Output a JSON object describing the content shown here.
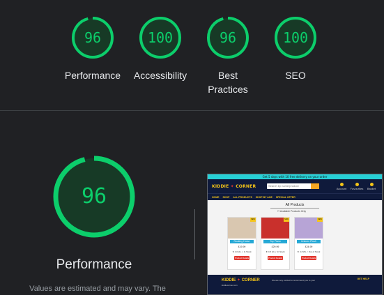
{
  "gauges": [
    {
      "score": "96",
      "label": "Performance",
      "color": "#0cce6b",
      "fraction": 0.96
    },
    {
      "score": "100",
      "label": "Accessibility",
      "color": "#0cce6b",
      "fraction": 1.0
    },
    {
      "score": "96",
      "label": "Best Practices",
      "color": "#0cce6b",
      "fraction": 0.96
    },
    {
      "score": "100",
      "label": "SEO",
      "color": "#0cce6b",
      "fraction": 1.0
    }
  ],
  "performance": {
    "score": "96",
    "fraction": 0.96,
    "title": "Performance",
    "note": "Values are estimated and may vary. The"
  },
  "thumbnail": {
    "banner": "Get 5 days with 10 free delivery on your order",
    "logo_left": "KIDDIE",
    "logo_right": "CORNER",
    "search_placeholder": "Search by name/product",
    "header_icons": [
      "Account",
      "Favourites",
      "Basket"
    ],
    "nav": [
      "HOME",
      "SHOP",
      "ALL PRODUCTS",
      "SHOP BY AGE",
      "SPECIAL OFFER"
    ],
    "page_title": "All Products",
    "filter_label": "Available Products Only",
    "cards": [
      {
        "name": "Rocking Horse",
        "price": "£19.99",
        "stock": "★ 4.0 (1)   ✓ In Stock",
        "button": "Product Details",
        "tag": "NEW",
        "img_color": "#d9c7b0"
      },
      {
        "name": "Toy Piano",
        "price": "£29.99",
        "stock": "★ 4.5 (3)   ✓ In Stock",
        "button": "Product Details",
        "tag": "NEW",
        "img_color": "#c9302c"
      },
      {
        "name": "Unicorn Plush",
        "price": "£24.99",
        "stock": "★ 4.8 (5)   ✓ Out of Stock",
        "button": "Product Details",
        "tag": "NEW",
        "img_color": "#b7a4d6"
      }
    ],
    "footer_text": "We are very excited to recommend you to your",
    "footer_head": "GET HELP",
    "footer_sub": "kiddiecorner.com"
  },
  "colors": {
    "background": "#202124",
    "pass": "#0cce6b",
    "pass_fill": "#173a26"
  }
}
